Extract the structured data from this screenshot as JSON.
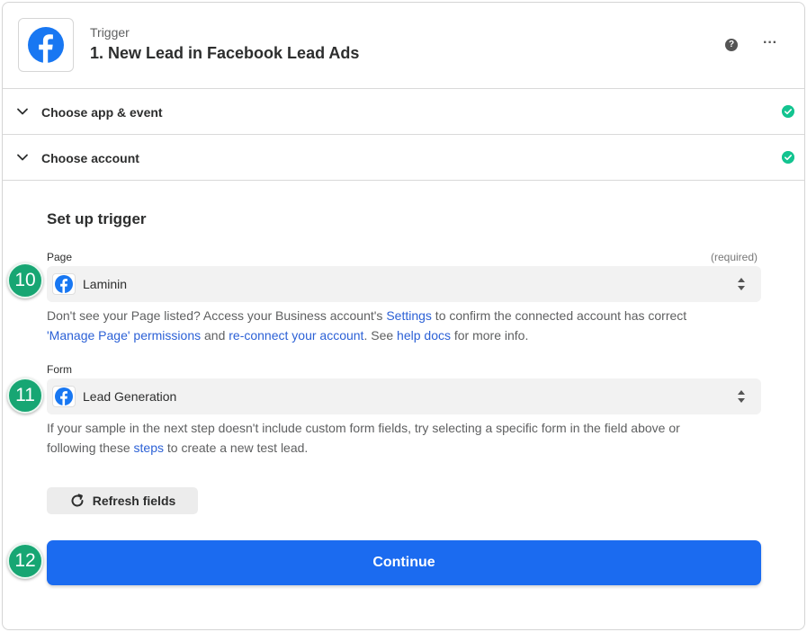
{
  "header": {
    "subtitle": "Trigger",
    "title": "1. New Lead in Facebook Lead Ads",
    "help_glyph": "?",
    "more_glyph": "···"
  },
  "sections": [
    {
      "label": "Choose app & event",
      "status": "complete"
    },
    {
      "label": "Choose account",
      "status": "complete"
    }
  ],
  "setup": {
    "title": "Set up trigger",
    "page_field": {
      "label": "Page",
      "required_text": "(required)",
      "value": "Laminin",
      "help": {
        "t1": "Don't see your Page listed? Access your Business account's ",
        "link_settings": "Settings",
        "t2": " to confirm the connected account has correct ",
        "link_permissions": "'Manage Page' permissions",
        "t3": " and ",
        "link_reconnect": "re-connect your account",
        "t4": ". See ",
        "link_docs": "help docs",
        "t5": " for more info."
      }
    },
    "form_field": {
      "label": "Form",
      "value": "Lead Generation",
      "help": {
        "t1": "If your sample in the next step doesn't include custom form fields, try selecting a specific form in the field above or following these ",
        "link_steps": "steps",
        "t2": " to create a new test lead."
      }
    },
    "refresh_label": "Refresh fields",
    "continue_label": "Continue"
  },
  "bubbles": [
    "10",
    "11",
    "12"
  ],
  "colors": {
    "facebook_blue": "#1877f2",
    "continue_blue": "#1b6bf0",
    "check_green": "#13c490",
    "bubble_green": "#17a673",
    "link_blue": "#2c61d6"
  },
  "icons": {
    "app": "facebook-icon",
    "section_toggle": "chevron-down-icon",
    "status": "check-circle-icon",
    "select": "sort-arrows-icon",
    "refresh": "refresh-icon"
  }
}
